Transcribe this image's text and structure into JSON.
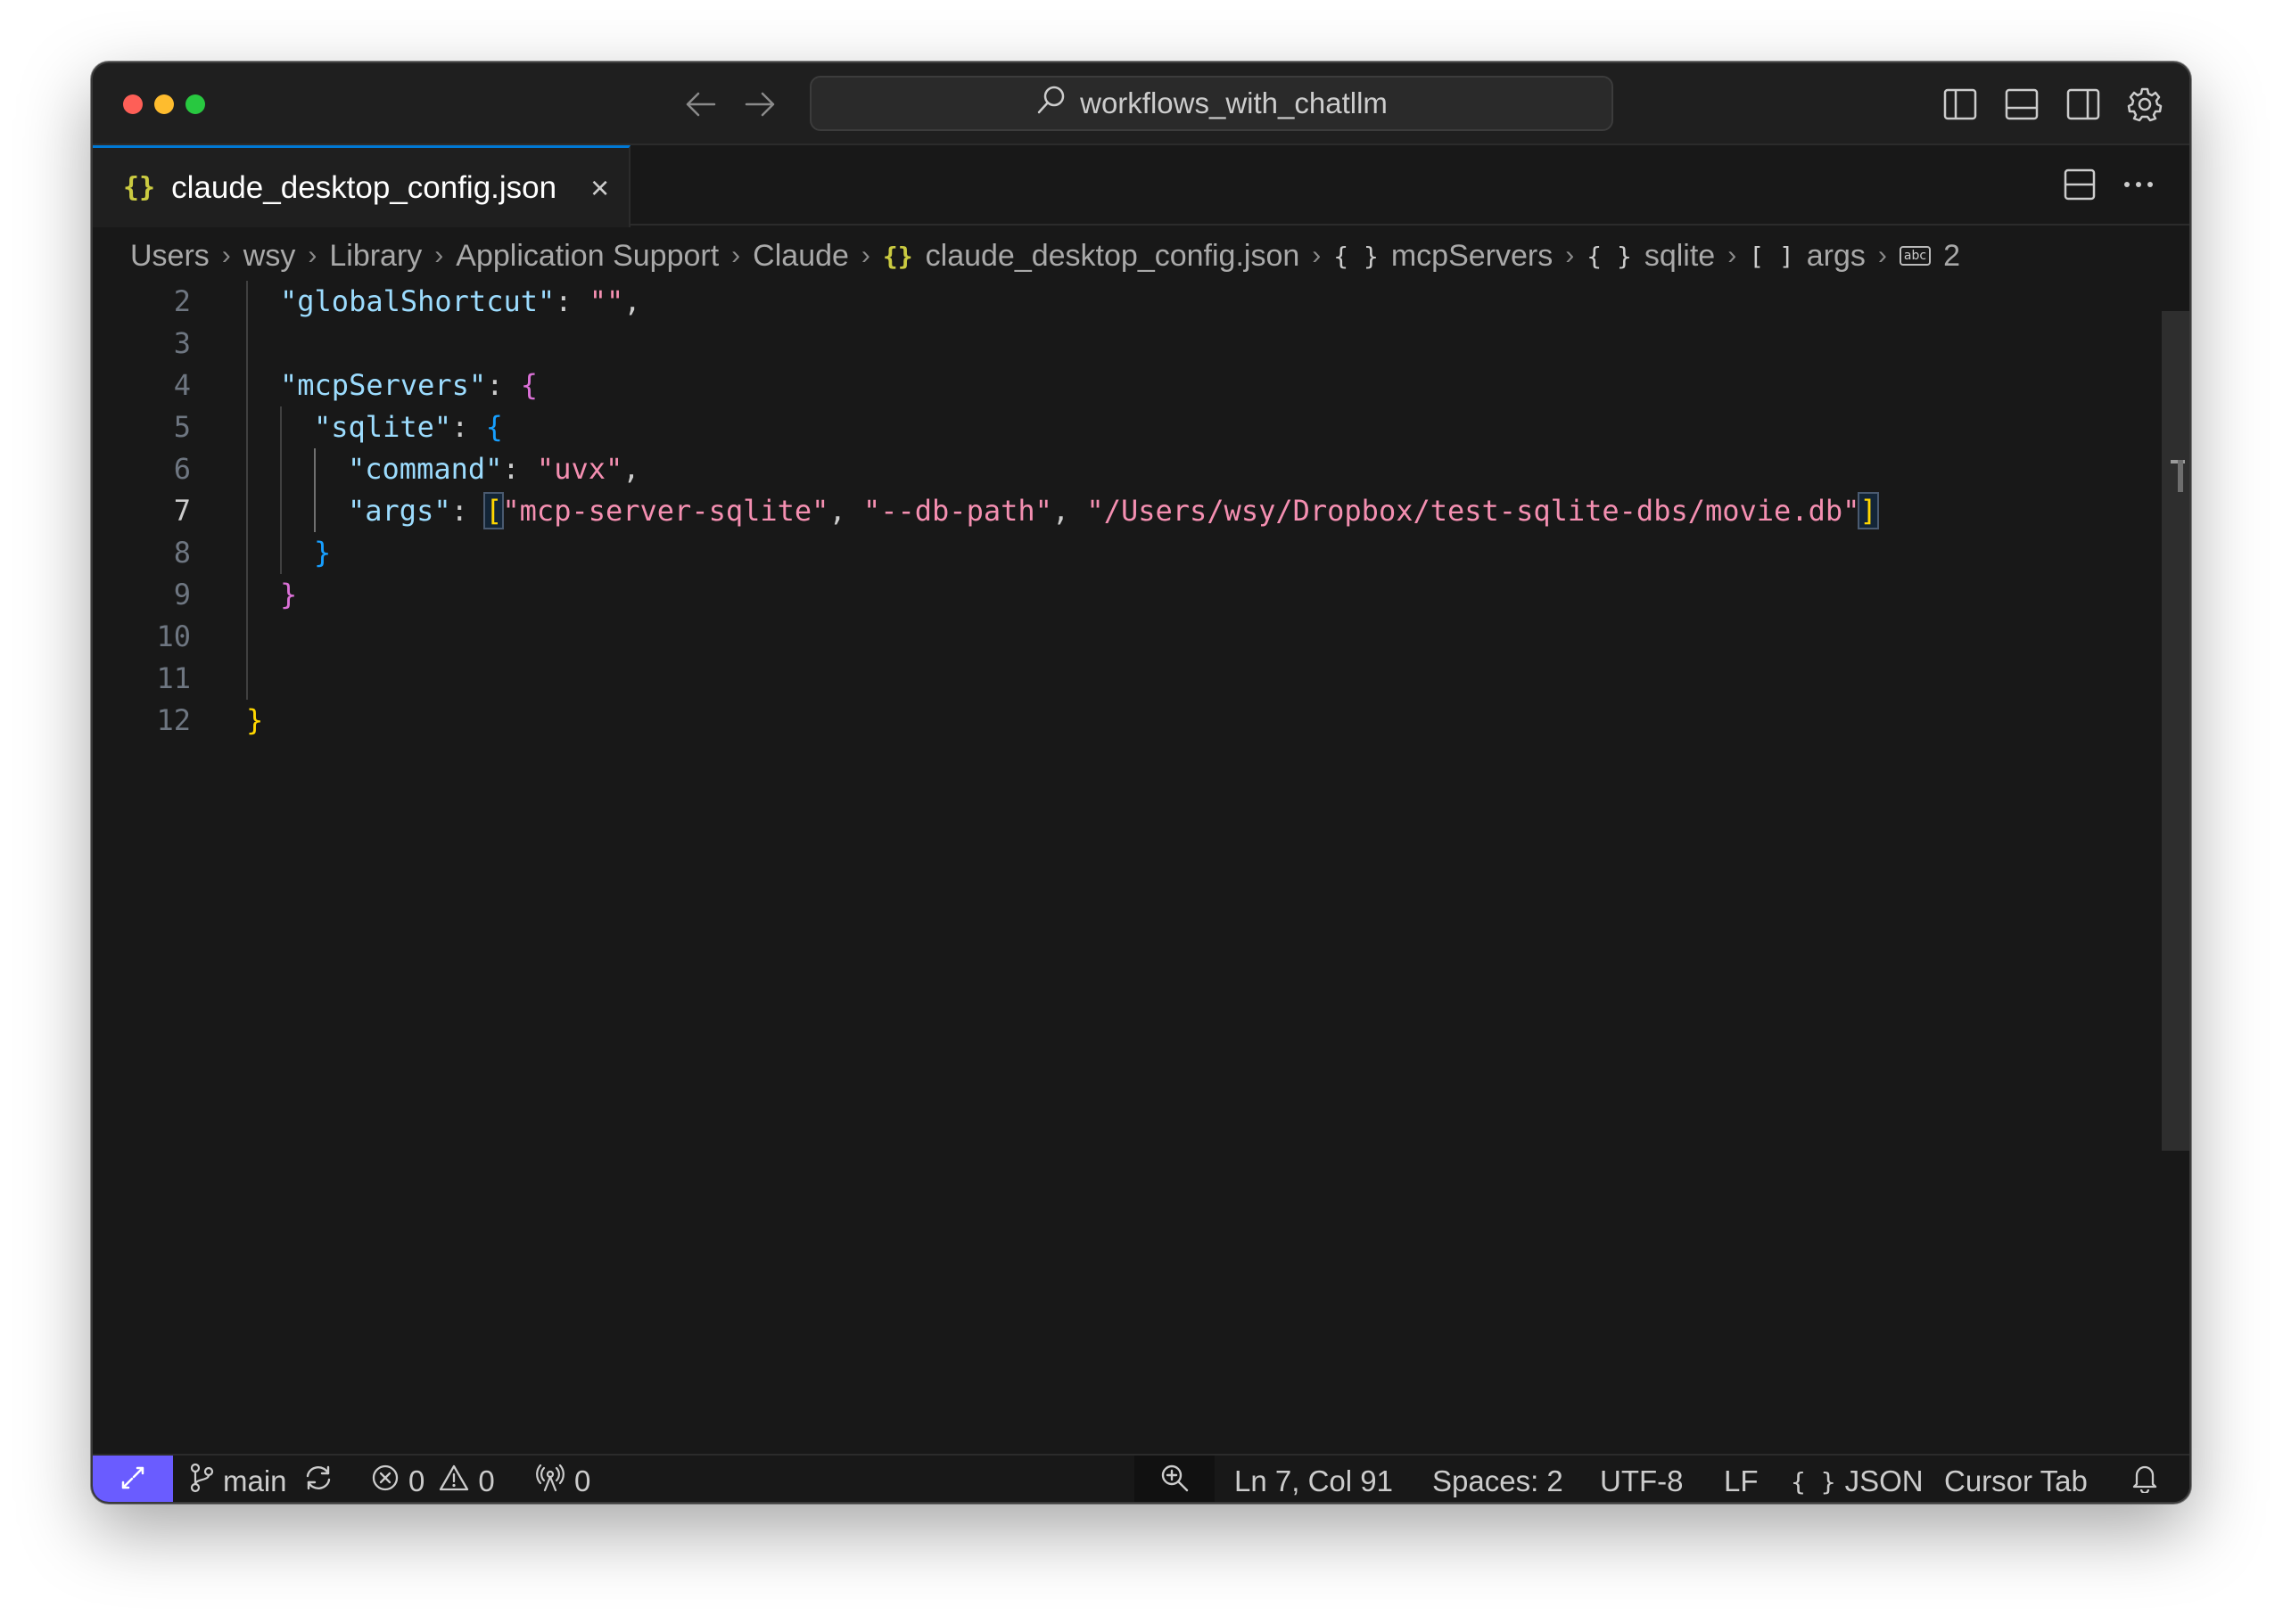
{
  "window": {
    "search_text": "workflows_with_chatllm"
  },
  "tab": {
    "icon_glyph": "{}",
    "label": "claude_desktop_config.json",
    "close_glyph": "×"
  },
  "breadcrumb": {
    "items": [
      "Users",
      "wsy",
      "Library",
      "Application Support",
      "Claude",
      "claude_desktop_config.json",
      "mcpServers",
      "sqlite",
      "args",
      "2"
    ],
    "json_glyph": "{}",
    "object_glyph": "{ }",
    "array_glyph": "[ ]",
    "abc_glyph": "abc"
  },
  "editor": {
    "line_numbers": [
      "2",
      "3",
      "4",
      "5",
      "6",
      "7",
      "8",
      "9",
      "10",
      "11",
      "12"
    ],
    "active_line": "7",
    "code": {
      "l2_key": "\"globalShortcut\"",
      "l2_colon": ": ",
      "l2_val": "\"\"",
      "l2_comma": ",",
      "l4_key": "\"mcpServers\"",
      "l4_colon": ": ",
      "l4_brace": "{",
      "l5_key": "\"sqlite\"",
      "l5_colon": ": ",
      "l5_brace": "{",
      "l6_key": "\"command\"",
      "l6_colon": ": ",
      "l6_val": "\"uvx\"",
      "l6_comma": ",",
      "l7_key": "\"args\"",
      "l7_colon": ": ",
      "l7_open": "[",
      "l7_v1": "\"mcp-server-sqlite\"",
      "l7_sep1": ", ",
      "l7_v2": "\"--db-path\"",
      "l7_sep2": ", ",
      "l7_v3": "\"/Users/wsy/Dropbox/test-sqlite-dbs/movie.db\"",
      "l7_close": "]",
      "l8_brace": "}",
      "l9_brace": "}",
      "l12_brace": "}"
    }
  },
  "statusbar": {
    "branch": "main",
    "errors": "0",
    "warnings": "0",
    "ports": "0",
    "cursor_position": "Ln 7, Col 91",
    "indent": "Spaces: 2",
    "encoding": "UTF-8",
    "eol": "LF",
    "language_glyph": "{ }",
    "language": "JSON",
    "cursor_tab": "Cursor Tab"
  },
  "colors": {
    "accent": "#0078d4",
    "remote_indicator": "#6a5cff",
    "background": "#181818",
    "json_key": "#9cdcfe",
    "json_string": "#ce9178",
    "json_string_args": "#f48fb1"
  },
  "icons": {
    "titlebar": [
      "arrow-left-icon",
      "arrow-right-icon",
      "search-icon",
      "toggle-primary-sidebar-icon",
      "toggle-panel-icon",
      "toggle-secondary-sidebar-icon",
      "settings-gear-icon"
    ],
    "tabbar": [
      "split-editor-icon",
      "more-actions-icon"
    ],
    "statusbar": [
      "remote-icon",
      "source-control-branch-icon",
      "sync-icon",
      "error-icon",
      "warning-icon",
      "broadcast-icon",
      "zoom-icon",
      "bell-icon"
    ]
  }
}
